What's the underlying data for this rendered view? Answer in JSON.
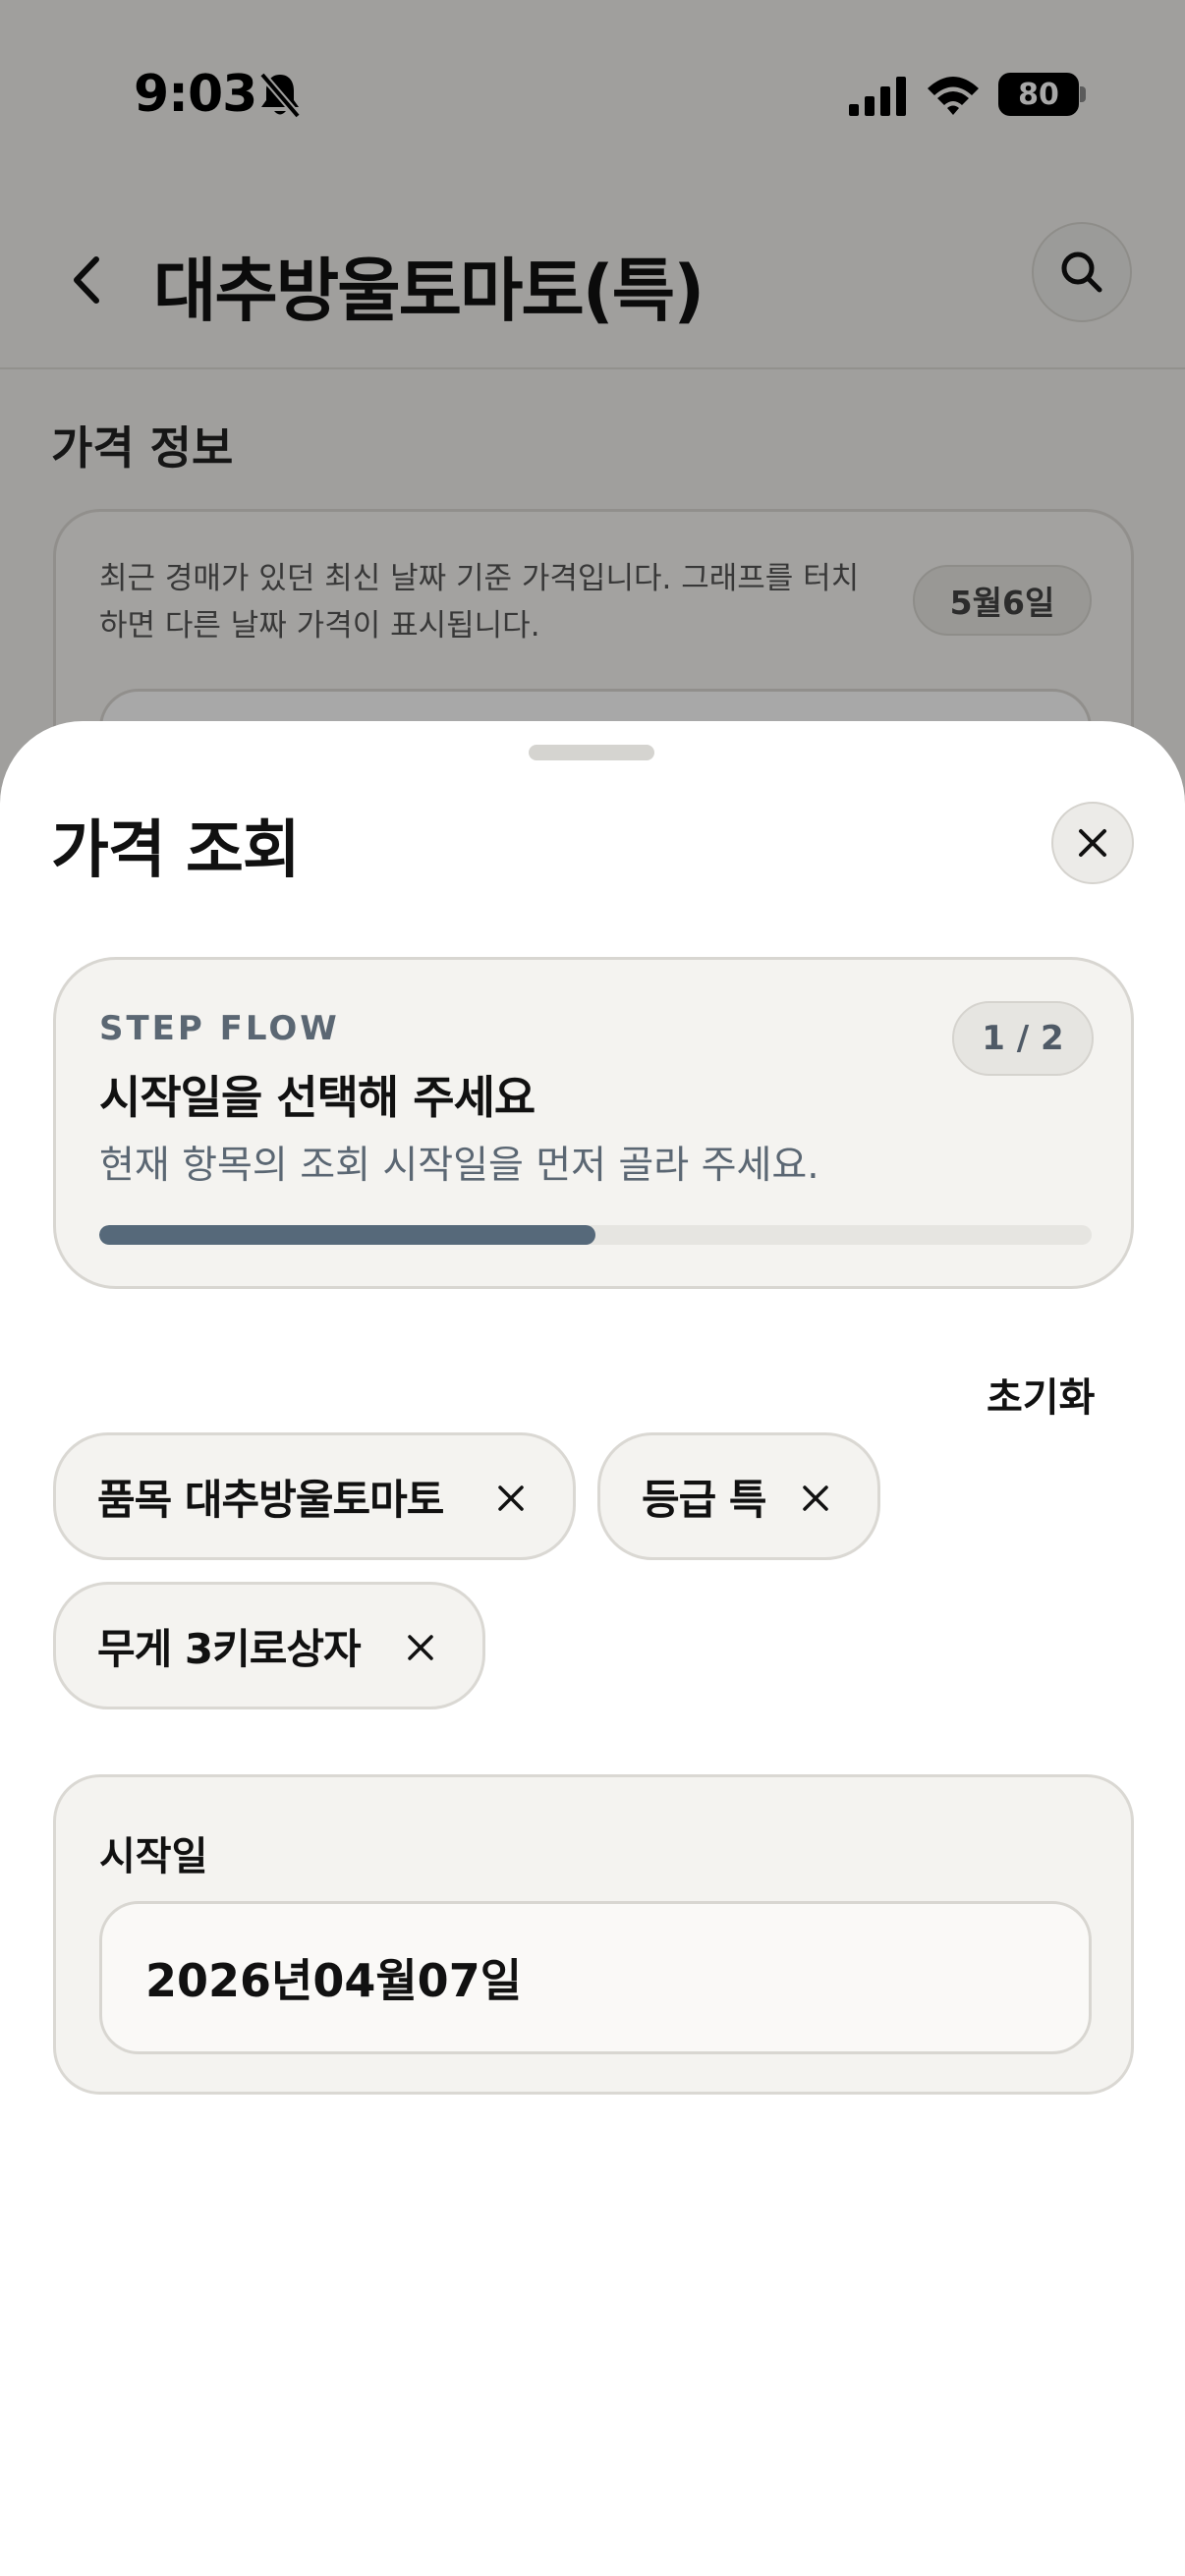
{
  "status_bar": {
    "time": "9:03",
    "battery": "80"
  },
  "header": {
    "title": "대추방울토마토(특)"
  },
  "price_info": {
    "section_title": "가격 정보",
    "description": "최근 경매가 있던 최신 날짜 기준 가격입니다. 그래프를 터치하면 다른 날짜 가격이 표시됩니다.",
    "date_badge": "5월6일"
  },
  "sheet": {
    "title": "가격 조회",
    "step": {
      "label": "STEP FLOW",
      "heading": "시작일을 선택해 주세요",
      "description": "현재 항목의 조회 시작일을 먼저 골라 주세요.",
      "counter": "1 / 2",
      "progress": 0.5
    },
    "reset_label": "초기화",
    "chips": [
      {
        "label": "품목 대추방울토마토"
      },
      {
        "label": "등급 특"
      },
      {
        "label": "무게 3키로상자"
      }
    ],
    "start_date": {
      "label": "시작일",
      "value": "2026년04월07일"
    }
  },
  "colors": {
    "accent": "#56697a",
    "muted_text": "#5b6773",
    "card_background": "#f4f3f0",
    "border": "#d8d6d1"
  },
  "icons": [
    "bell-slash-icon",
    "signal-icon",
    "wifi-icon",
    "battery-icon",
    "back-chevron-icon",
    "search-icon",
    "close-icon"
  ]
}
